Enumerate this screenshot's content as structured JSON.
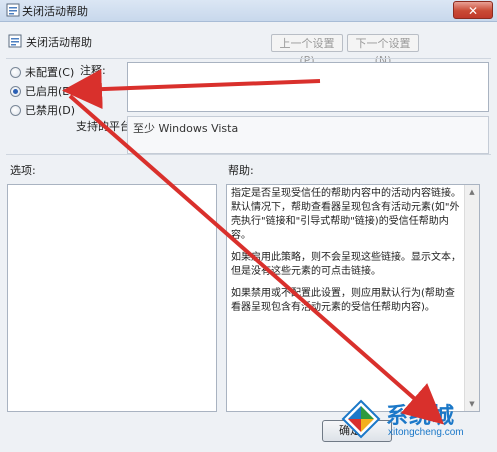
{
  "window": {
    "title": "关闭活动帮助",
    "close_label": "✕"
  },
  "header": {
    "title": "关闭活动帮助",
    "prev_button": "上一个设置(P)",
    "next_button": "下一个设置(N)"
  },
  "state": {
    "options": [
      {
        "label": "未配置(C)",
        "checked": false
      },
      {
        "label": "已启用(E)",
        "checked": true
      },
      {
        "label": "已禁用(D)",
        "checked": false
      }
    ]
  },
  "comment": {
    "label": "注释:",
    "value": ""
  },
  "platform": {
    "label": "支持的平台:",
    "value": "至少 Windows Vista"
  },
  "options_pane": {
    "label": "选项:"
  },
  "help_pane": {
    "label": "帮助:",
    "paragraphs": [
      "指定是否呈现受信任的帮助内容中的活动内容链接。默认情况下，帮助查看器呈现包含有活动元素(如\"外壳执行\"链接和\"引导式帮助\"链接)的受信任帮助内容。",
      "如果启用此策略，则不会呈现这些链接。显示文本，但是没有这些元素的可点击链接。",
      "如果禁用或不配置此设置，则应用默认行为(帮助查看器呈现包含有活动元素的受信任帮助内容)。"
    ]
  },
  "footer": {
    "ok_button": "确定"
  },
  "watermark": {
    "name": "系统城",
    "url": "xitongcheng.com"
  },
  "colors": {
    "annotation_arrow": "#d9302c",
    "watermark_blue": "#1b78c8"
  }
}
